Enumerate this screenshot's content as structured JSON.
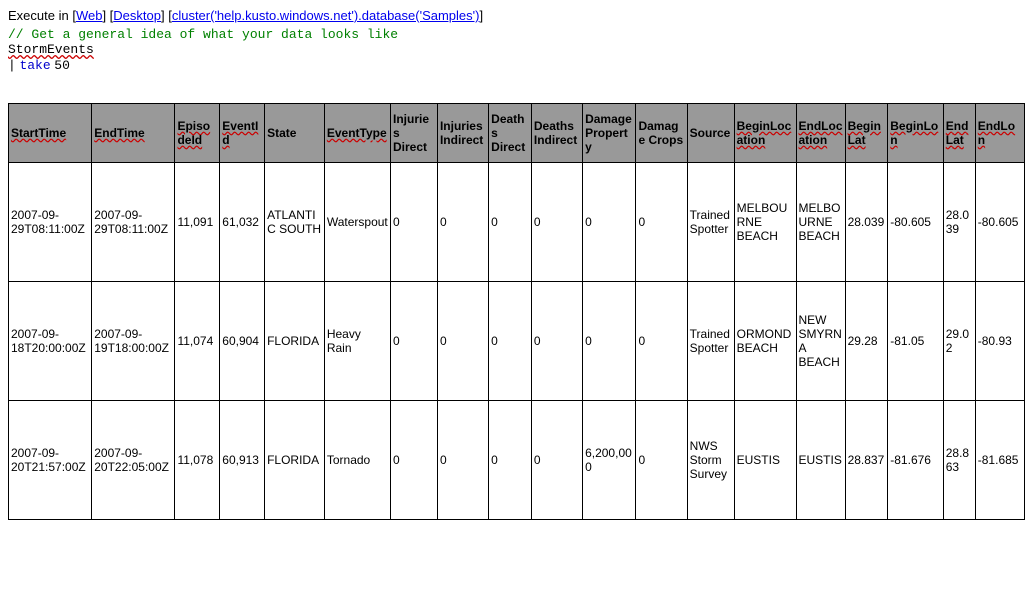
{
  "header": {
    "execute_label": "Execute in",
    "link_web": "Web",
    "link_desktop": "Desktop",
    "link_cluster": "cluster('help.kusto.windows.net').database('Samples')"
  },
  "code": {
    "comment": "// Get a general idea of what your data looks like",
    "table_name": "StormEvents",
    "pipe": "|",
    "take_keyword": "take",
    "take_number": "50"
  },
  "table": {
    "headers": [
      {
        "text": "StartTime",
        "wavy": true
      },
      {
        "text": "EndTime",
        "wavy": true
      },
      {
        "text": "EpisodeId",
        "wavy": true
      },
      {
        "text": "EventId",
        "wavy": true
      },
      {
        "text": "State",
        "wavy": false
      },
      {
        "text": "EventType",
        "wavy": true
      },
      {
        "text": "Injuries Direct",
        "wavy": false
      },
      {
        "text": "Injuries Indirect",
        "wavy": false
      },
      {
        "text": "Deaths Direct",
        "wavy": false
      },
      {
        "text": "Deaths Indirect",
        "wavy": false
      },
      {
        "text": "Damage Property",
        "wavy": false
      },
      {
        "text": "Damage Crops",
        "wavy": false
      },
      {
        "text": "Source",
        "wavy": false
      },
      {
        "text": "BeginLocation",
        "wavy": true
      },
      {
        "text": "EndLocation",
        "wavy": true
      },
      {
        "text": "BeginLat",
        "wavy": true
      },
      {
        "text": "BeginLon",
        "wavy": true
      },
      {
        "text": "EndLat",
        "wavy": true
      },
      {
        "text": "EndLon",
        "wavy": true
      }
    ],
    "rows": [
      {
        "StartTime": "2007-09-29T08:11:00Z",
        "EndTime": "2007-09-29T08:11:00Z",
        "EpisodeId": "11,091",
        "EventId": "61,032",
        "State": "ATLANTIC SOUTH",
        "EventType": "Waterspout",
        "InjuriesDirect": "0",
        "InjuriesIndirect": "0",
        "DeathsDirect": "0",
        "DeathsIndirect": "0",
        "DamageProperty": "0",
        "DamageCrops": "0",
        "Source": "Trained Spotter",
        "BeginLocation": "MELBOURNE BEACH",
        "EndLocation": "MELBOURNE BEACH",
        "BeginLat": "28.039",
        "BeginLon": "-80.605",
        "EndLat": "28.039",
        "EndLon": "-80.605"
      },
      {
        "StartTime": "2007-09-18T20:00:00Z",
        "EndTime": "2007-09-19T18:00:00Z",
        "EpisodeId": "11,074",
        "EventId": "60,904",
        "State": "FLORIDA",
        "EventType": "Heavy Rain",
        "InjuriesDirect": "0",
        "InjuriesIndirect": "0",
        "DeathsDirect": "0",
        "DeathsIndirect": "0",
        "DamageProperty": "0",
        "DamageCrops": "0",
        "Source": "Trained Spotter",
        "BeginLocation": "ORMOND BEACH",
        "EndLocation": "NEW SMYRNA BEACH",
        "BeginLat": "29.28",
        "BeginLon": "-81.05",
        "EndLat": "29.02",
        "EndLon": "-80.93"
      },
      {
        "StartTime": "2007-09-20T21:57:00Z",
        "EndTime": "2007-09-20T22:05:00Z",
        "EpisodeId": "11,078",
        "EventId": "60,913",
        "State": "FLORIDA",
        "EventType": "Tornado",
        "InjuriesDirect": "0",
        "InjuriesIndirect": "0",
        "DeathsDirect": "0",
        "DeathsIndirect": "0",
        "DamageProperty": "6,200,000",
        "DamageCrops": "0",
        "Source": "NWS Storm Survey",
        "BeginLocation": "EUSTIS",
        "EndLocation": "EUSTIS",
        "BeginLat": "28.837",
        "BeginLon": "-81.676",
        "EndLat": "28.863",
        "EndLon": "-81.685"
      }
    ]
  }
}
